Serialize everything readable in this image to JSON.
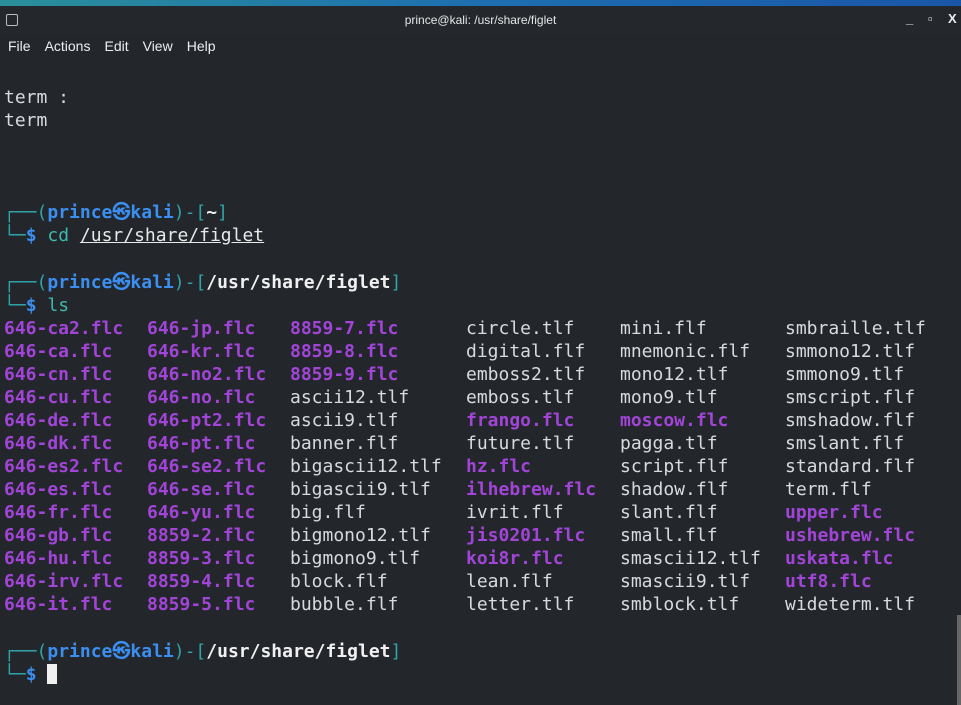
{
  "window": {
    "title": "prince@kali: /usr/share/figlet",
    "minimize": "_",
    "maximize": "▫",
    "close": "X"
  },
  "menu": [
    "File",
    "Actions",
    "Edit",
    "View",
    "Help"
  ],
  "output_prev": [
    "term :",
    "term"
  ],
  "prompts": [
    {
      "user": "prince",
      "host": "kali",
      "dir": "~",
      "command": "cd",
      "arg": "/usr/share/figlet"
    },
    {
      "user": "prince",
      "host": "kali",
      "dir": "/usr/share/figlet",
      "command": "ls",
      "arg": ""
    },
    {
      "user": "prince",
      "host": "kali",
      "dir": "/usr/share/figlet",
      "command": "",
      "arg": ""
    }
  ],
  "colors": {
    "flc": "#a244d8",
    "prompt": "#2fa4a8",
    "user": "#3b8ff0",
    "background": "#23272c"
  },
  "ls_columns": [
    [
      "646-ca2.flc",
      "646-ca.flc",
      "646-cn.flc",
      "646-cu.flc",
      "646-de.flc",
      "646-dk.flc",
      "646-es2.flc",
      "646-es.flc",
      "646-fr.flc",
      "646-gb.flc",
      "646-hu.flc",
      "646-irv.flc",
      "646-it.flc"
    ],
    [
      "646-jp.flc",
      "646-kr.flc",
      "646-no2.flc",
      "646-no.flc",
      "646-pt2.flc",
      "646-pt.flc",
      "646-se2.flc",
      "646-se.flc",
      "646-yu.flc",
      "8859-2.flc",
      "8859-3.flc",
      "8859-4.flc",
      "8859-5.flc"
    ],
    [
      "8859-7.flc",
      "8859-8.flc",
      "8859-9.flc",
      "ascii12.tlf",
      "ascii9.tlf",
      "banner.flf",
      "bigascii12.tlf",
      "bigascii9.tlf",
      "big.flf",
      "bigmono12.tlf",
      "bigmono9.tlf",
      "block.flf",
      "bubble.flf"
    ],
    [
      "circle.tlf",
      "digital.flf",
      "emboss2.tlf",
      "emboss.tlf",
      "frango.flc",
      "future.tlf",
      "hz.flc",
      "ilhebrew.flc",
      "ivrit.flf",
      "jis0201.flc",
      "koi8r.flc",
      "lean.flf",
      "letter.tlf"
    ],
    [
      "mini.flf",
      "mnemonic.flf",
      "mono12.tlf",
      "mono9.tlf",
      "moscow.flc",
      "pagga.tlf",
      "script.flf",
      "shadow.flf",
      "slant.flf",
      "small.flf",
      "smascii12.tlf",
      "smascii9.tlf",
      "smblock.tlf"
    ],
    [
      "smbraille.tlf",
      "smmono12.tlf",
      "smmono9.tlf",
      "smscript.flf",
      "smshadow.flf",
      "smslant.flf",
      "standard.flf",
      "term.flf",
      "upper.flc",
      "ushebrew.flc",
      "uskata.flc",
      "utf8.flc",
      "wideterm.tlf"
    ]
  ]
}
